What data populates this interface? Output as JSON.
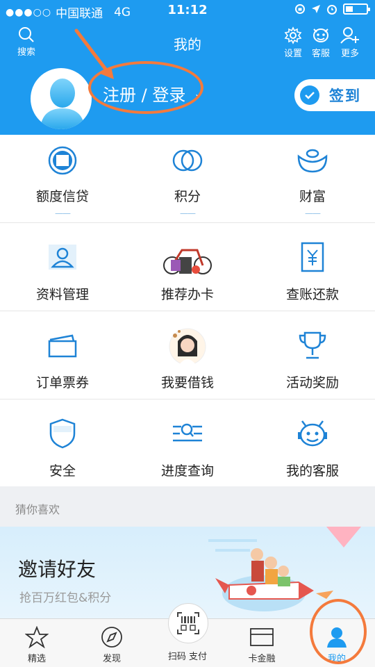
{
  "status_bar": {
    "signal": "●●●○○",
    "carrier": "中国联通",
    "network": "4G",
    "time": "11:12"
  },
  "header": {
    "title": "我的",
    "search_label": "搜索",
    "settings_label": "设置",
    "service_label": "客服",
    "more_label": "更多",
    "login_text": "注册 / 登录",
    "checkin_label": "签到",
    "bg_color": "#1e9bf0"
  },
  "grid": {
    "row1": [
      {
        "label": "额度信贷",
        "sub": "——",
        "icon": "credit-quota-icon"
      },
      {
        "label": "积分",
        "sub": "——",
        "icon": "points-icon"
      },
      {
        "label": "财富",
        "sub": "——",
        "icon": "wealth-icon"
      }
    ],
    "row2": [
      {
        "label": "资料管理",
        "icon": "profile-icon"
      },
      {
        "label": "推荐办卡",
        "icon": "recommend-card-image"
      },
      {
        "label": "查账还款",
        "icon": "bill-icon"
      }
    ],
    "row3": [
      {
        "label": "订单票券",
        "icon": "ticket-icon"
      },
      {
        "label": "我要借钱",
        "icon": "borrow-image"
      },
      {
        "label": "活动奖励",
        "icon": "trophy-icon"
      }
    ],
    "row4": [
      {
        "label": "安全",
        "icon": "shield-icon"
      },
      {
        "label": "进度查询",
        "icon": "progress-search-icon"
      },
      {
        "label": "我的客服",
        "icon": "service-bot-icon"
      }
    ],
    "icon_color": "#1e83d6"
  },
  "guess": {
    "title": "猜你喜欢"
  },
  "banner": {
    "title": "邀请好友",
    "subtitle": "抢百万红包&积分"
  },
  "tabbar": {
    "items": [
      {
        "label": "精选"
      },
      {
        "label": "发现"
      },
      {
        "label": "扫码 支付"
      },
      {
        "label": "卡金融"
      },
      {
        "label": "我的"
      }
    ],
    "active_color": "#1e9bf0"
  },
  "annotation_color": "#f47a3c"
}
